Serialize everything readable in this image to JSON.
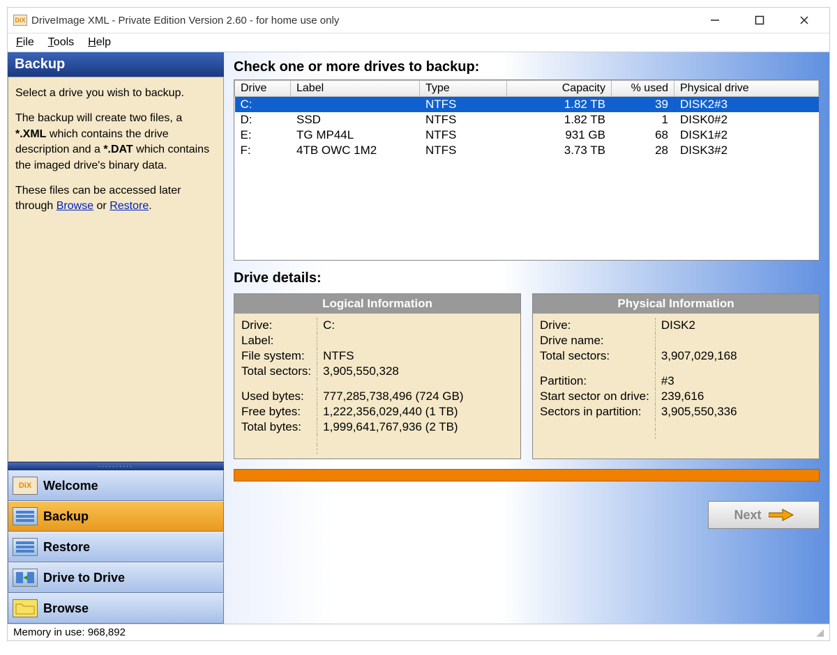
{
  "window": {
    "title": "DriveImage XML - Private Edition Version 2.60 - for home use only",
    "icon_label": "DiX"
  },
  "menubar": {
    "items": [
      "File",
      "Tools",
      "Help"
    ]
  },
  "sidebar": {
    "header": "Backup",
    "desc_p1": "Select a drive you wish to backup.",
    "desc_p2a": "The backup will create two files, a  ",
    "desc_p2b": "*.XML",
    "desc_p2c": " which contains the drive description and a ",
    "desc_p2d": "*.DAT",
    "desc_p2e": " which contains the imaged drive's binary data.",
    "desc_p3a": "These files can be accessed later through ",
    "link_browse": "Browse",
    "desc_p3b": " or ",
    "link_restore": "Restore",
    "desc_p3c": ".",
    "nav": [
      {
        "label": "Welcome",
        "active": false
      },
      {
        "label": "Backup",
        "active": true
      },
      {
        "label": "Restore",
        "active": false
      },
      {
        "label": "Drive to Drive",
        "active": false
      },
      {
        "label": "Browse",
        "active": false
      }
    ]
  },
  "main": {
    "heading": "Check one or more drives to backup:",
    "columns": {
      "drive": "Drive",
      "label": "Label",
      "type": "Type",
      "capacity": "Capacity",
      "used": "% used",
      "physical": "Physical drive"
    },
    "rows": [
      {
        "drive": "C:",
        "label": "",
        "type": "NTFS",
        "capacity": "1.82 TB",
        "used": "39",
        "physical": "DISK2#3",
        "selected": true
      },
      {
        "drive": "D:",
        "label": "SSD",
        "type": "NTFS",
        "capacity": "1.82 TB",
        "used": "1",
        "physical": "DISK0#2",
        "selected": false
      },
      {
        "drive": "E:",
        "label": "TG MP44L",
        "type": "NTFS",
        "capacity": "931 GB",
        "used": "68",
        "physical": "DISK1#2",
        "selected": false
      },
      {
        "drive": "F:",
        "label": "4TB OWC 1M2",
        "type": "NTFS",
        "capacity": "3.73 TB",
        "used": "28",
        "physical": "DISK3#2",
        "selected": false
      }
    ],
    "details_heading": "Drive details:",
    "logical": {
      "title": "Logical Information",
      "drive_k": "Drive:",
      "drive_v": "C:",
      "label_k": "Label:",
      "label_v": "",
      "fs_k": "File system:",
      "fs_v": "NTFS",
      "ts_k": "Total sectors:",
      "ts_v": "3,905,550,328",
      "ub_k": "Used bytes:",
      "ub_v": "777,285,738,496 (724 GB)",
      "fb_k": "Free bytes:",
      "fb_v": "1,222,356,029,440 (1 TB)",
      "tb_k": "Total bytes:",
      "tb_v": "1,999,641,767,936 (2 TB)"
    },
    "physical": {
      "title": "Physical Information",
      "drive_k": "Drive:",
      "drive_v": "DISK2",
      "dn_k": "Drive name:",
      "dn_v": "",
      "ts_k": "Total sectors:",
      "ts_v": "3,907,029,168",
      "part_k": "Partition:",
      "part_v": "#3",
      "ss_k": "Start sector on drive:",
      "ss_v": "239,616",
      "sp_k": "Sectors in partition:",
      "sp_v": "3,905,550,336"
    },
    "next_label": "Next"
  },
  "statusbar": {
    "text": "Memory in use: 968,892"
  }
}
